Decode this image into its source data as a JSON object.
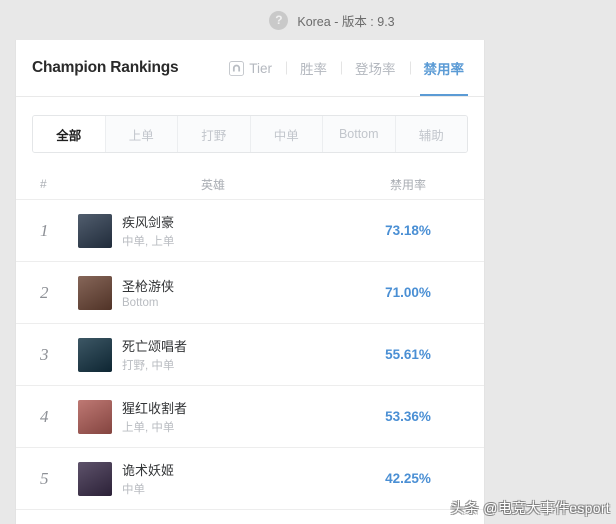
{
  "topbar": {
    "help_icon": "question-mark-icon",
    "region_version": "Korea - 版本 : 9.3"
  },
  "card": {
    "title": "Champion Rankings",
    "tabs": [
      {
        "label": "Tier",
        "icon": "tier-helmet-icon",
        "active": false
      },
      {
        "label": "胜率",
        "active": false
      },
      {
        "label": "登场率",
        "active": false
      },
      {
        "label": "禁用率",
        "active": true
      }
    ],
    "filters": [
      {
        "label": "全部",
        "active": true
      },
      {
        "label": "上单",
        "active": false
      },
      {
        "label": "打野",
        "active": false
      },
      {
        "label": "中单",
        "active": false
      },
      {
        "label": "Bottom",
        "active": false
      },
      {
        "label": "辅助",
        "active": false
      }
    ],
    "table": {
      "headers": {
        "rank": "#",
        "champion": "英雄",
        "rate": "禁用率"
      },
      "rows": [
        {
          "rank": "1",
          "name": "疾风剑豪",
          "roles": "中单, 上单",
          "rate": "73.18%",
          "avatar_color": "#2b3a4e"
        },
        {
          "rank": "2",
          "name": "圣枪游侠",
          "roles": "Bottom",
          "rate": "71.00%",
          "avatar_color": "#6b4434"
        },
        {
          "rank": "3",
          "name": "死亡颂唱者",
          "roles": "打野, 中单",
          "rate": "55.61%",
          "avatar_color": "#123243"
        },
        {
          "rank": "4",
          "name": "猩红收割者",
          "roles": "上单, 中单",
          "rate": "53.36%",
          "avatar_color": "#b05b55"
        },
        {
          "rank": "5",
          "name": "诡术妖姬",
          "roles": "中单",
          "rate": "42.25%",
          "avatar_color": "#3a2c4a"
        }
      ]
    }
  },
  "watermark": "头条 @电竞大事件esport",
  "colors": {
    "accent": "#5b9bd5",
    "rate_text": "#4a8fd4",
    "page_background": "#e8e8e8"
  }
}
